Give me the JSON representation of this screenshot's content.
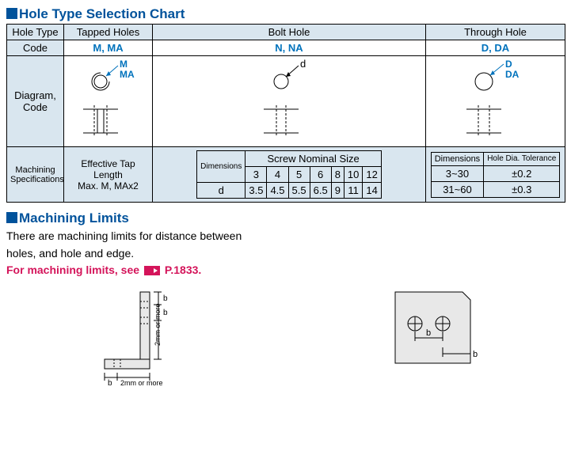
{
  "holeChart": {
    "title": "Hole Type Selection Chart",
    "headers": {
      "holeType": "Hole Type",
      "tapped": "Tapped Holes",
      "bolt": "Bolt Hole",
      "through": "Through Hole"
    },
    "rows": {
      "code": {
        "label": "Code",
        "tapped": "M, MA",
        "bolt": "N, NA",
        "through": "D, DA"
      },
      "diagram": {
        "label": "Diagram,\nCode",
        "tappedLabel1": "M",
        "tappedLabel2": "MA",
        "boltLabel": "d",
        "throughLabel1": "D",
        "throughLabel2": "DA"
      },
      "spec": {
        "label": "Machining\nSpecifications",
        "tapped": "Effective Tap Length\nMax. M, MAx2",
        "bolt": {
          "dimLabel": "Dimensions",
          "nominalTitle": "Screw Nominal Size",
          "sizes": [
            "3",
            "4",
            "5",
            "6",
            "8",
            "10",
            "12"
          ],
          "dLabel": "d",
          "dVals": [
            "3.5",
            "4.5",
            "5.5",
            "6.5",
            "9",
            "11",
            "14"
          ]
        },
        "through": {
          "dimHeader": "Dimensions",
          "tolHeader": "Hole Dia. Tolerance",
          "rows": [
            {
              "dim": "3~30",
              "tol": "±0.2"
            },
            {
              "dim": "31~60",
              "tol": "±0.3"
            }
          ]
        }
      }
    }
  },
  "limits": {
    "title": "Machining Limits",
    "line1": "There are machining limits for distance between",
    "line2": "holes, and hole and edge.",
    "redPrefix": "For machining limits, see",
    "pageRef": "P.1833",
    "diagLabels": {
      "b": "b",
      "twoOrMore": "2mm or more"
    }
  }
}
